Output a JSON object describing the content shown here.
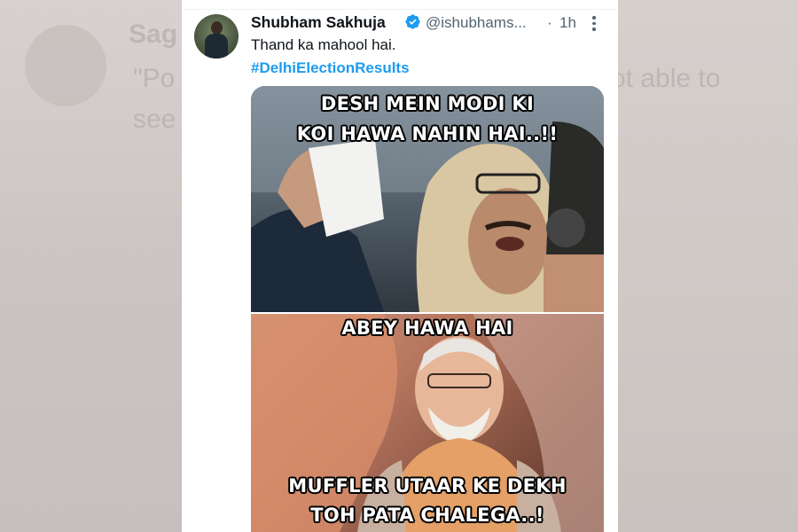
{
  "tweet": {
    "author_name": "Shubham Sakhuja",
    "handle": "@ishubhams...",
    "separator": "·",
    "time": "1h",
    "text": "Thand ka mahool hai.",
    "hashtag": "#DelhiElectionResults"
  },
  "meme": {
    "top_line1": "DESH MEIN MODI KI",
    "top_line2": "KOI HAWA NAHIN HAI..!!",
    "middle_line": "ABEY HAWA HAI",
    "bottom_line1": "MUFFLER UTAAR KE DEKH",
    "bottom_line2": "TOH PATA CHALEGA..!"
  },
  "background": {
    "ghost_name": "Sag",
    "ghost_text1": "\"Po",
    "ghost_text2": "see",
    "ghost_text3": "ot able to"
  },
  "colors": {
    "link": "#1d9bf0",
    "verified": "#1d9bf0",
    "text_primary": "#0f1419",
    "text_secondary": "#536471"
  },
  "icons": [
    "verified-badge-icon",
    "more-options-icon"
  ]
}
